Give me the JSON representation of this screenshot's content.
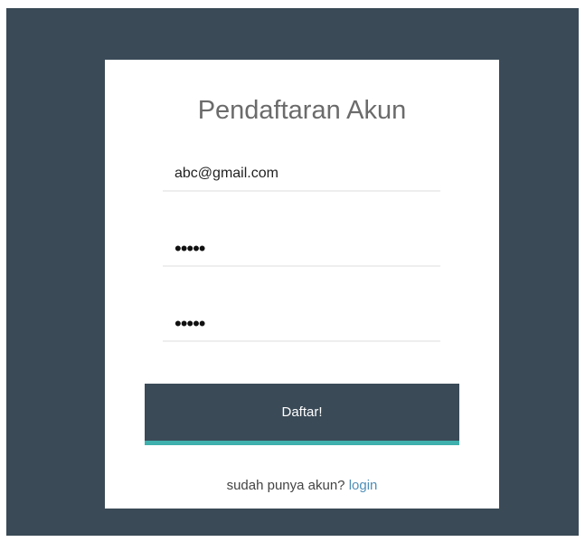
{
  "form": {
    "title": "Pendaftaran Akun",
    "email_value": "abc@gmail.com",
    "password_value": "•••••",
    "confirm_password_value": "•••••",
    "submit_label": "Daftar!",
    "footer_text": "sudah punya akun?",
    "login_link": "login"
  },
  "colors": {
    "background": "#3a4a57",
    "card": "#ffffff",
    "accent": "#3fb0ad",
    "link": "#4f8fb8"
  }
}
